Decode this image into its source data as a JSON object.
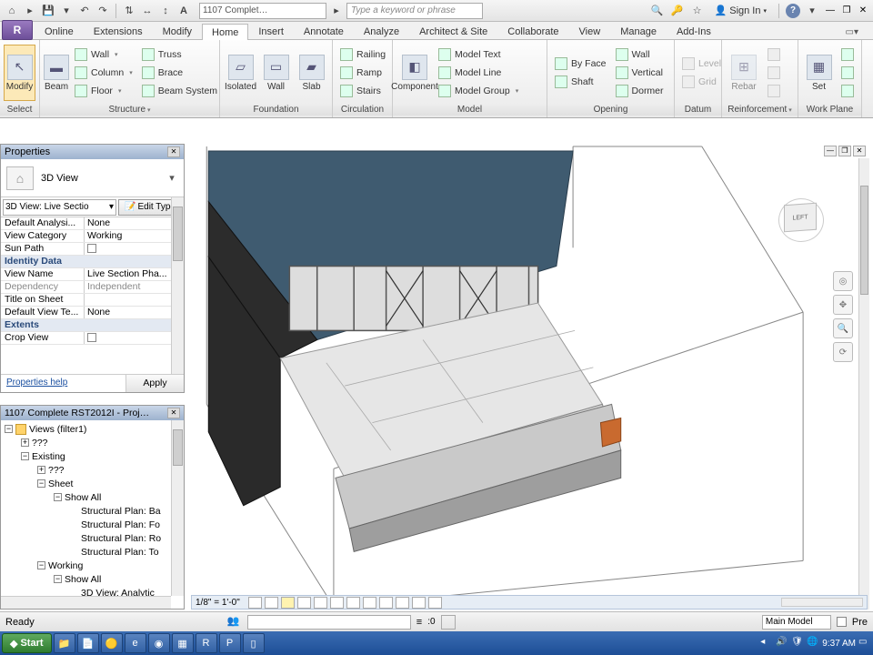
{
  "qat": {
    "title_field": "1107 Complet…",
    "search_placeholder": "Type a keyword or phrase",
    "signin": "Sign In"
  },
  "tabs": [
    "Online",
    "Extensions",
    "Modify",
    "Home",
    "Insert",
    "Annotate",
    "Analyze",
    "Architect & Site",
    "Collaborate",
    "View",
    "Manage",
    "Add-Ins"
  ],
  "active_tab": "Home",
  "ribbon": {
    "select": {
      "modify": "Modify",
      "panel": "Select"
    },
    "structure": {
      "beam": "Beam",
      "wall": "Wall",
      "column": "Column",
      "floor": "Floor",
      "truss": "Truss",
      "brace": "Brace",
      "beam_system": "Beam System",
      "panel": "Structure"
    },
    "foundation": {
      "isolated": "Isolated",
      "wall": "Wall",
      "slab": "Slab",
      "panel": "Foundation"
    },
    "circulation": {
      "railing": "Railing",
      "ramp": "Ramp",
      "stairs": "Stairs",
      "panel": "Circulation"
    },
    "model": {
      "component": "Component",
      "model_text": "Model Text",
      "model_line": "Model Line",
      "model_group": "Model Group",
      "panel": "Model"
    },
    "opening": {
      "by_face": "By Face",
      "shaft": "Shaft",
      "wall": "Wall",
      "vertical": "Vertical",
      "dormer": "Dormer",
      "panel": "Opening"
    },
    "datum": {
      "level": "Level",
      "grid": "Grid",
      "panel": "Datum"
    },
    "reinforcement": {
      "rebar": "Rebar",
      "panel": "Reinforcement"
    },
    "workplane": {
      "set": "Set",
      "panel": "Work Plane"
    }
  },
  "properties": {
    "title": "Properties",
    "type": "3D View",
    "instance_combo": "3D View: Live Sectio",
    "edit_type": "Edit Type",
    "rows": [
      {
        "k": "Default Analysi...",
        "v": "None"
      },
      {
        "k": "View Category",
        "v": "Working"
      },
      {
        "k": "Sun Path",
        "v": "",
        "cb": true
      }
    ],
    "cat1": "Identity Data",
    "rows2": [
      {
        "k": "View Name",
        "v": "Live Section Pha..."
      },
      {
        "k": "Dependency",
        "v": "Independent",
        "ro": true
      },
      {
        "k": "Title on Sheet",
        "v": ""
      },
      {
        "k": "Default View Te...",
        "v": "None"
      }
    ],
    "cat2": "Extents",
    "rows3": [
      {
        "k": "Crop View",
        "v": "",
        "cb": true
      }
    ],
    "help": "Properties help",
    "apply": "Apply"
  },
  "browser": {
    "title": "1107 Complete RST2012I - Proj…",
    "root": "Views (filter1)",
    "n1": "???",
    "n2": "Existing",
    "n3": "???",
    "n4": "Sheet",
    "n5": "Show All",
    "leaves": [
      "Structural Plan: Ba",
      "Structural Plan: Fo",
      "Structural Plan: Ro",
      "Structural Plan: To"
    ],
    "n6": "Working",
    "n7": "Show All",
    "n8": "3D View: Analytic"
  },
  "viewcube": {
    "face": "LEFT"
  },
  "vcb": {
    "scale": "1/8\" = 1'-0\""
  },
  "status": {
    "ready": "Ready",
    "filter_val": ":0",
    "main_model": "Main Model",
    "pre": "Pre"
  },
  "taskbar": {
    "start": "Start",
    "time": "9:37 AM"
  }
}
